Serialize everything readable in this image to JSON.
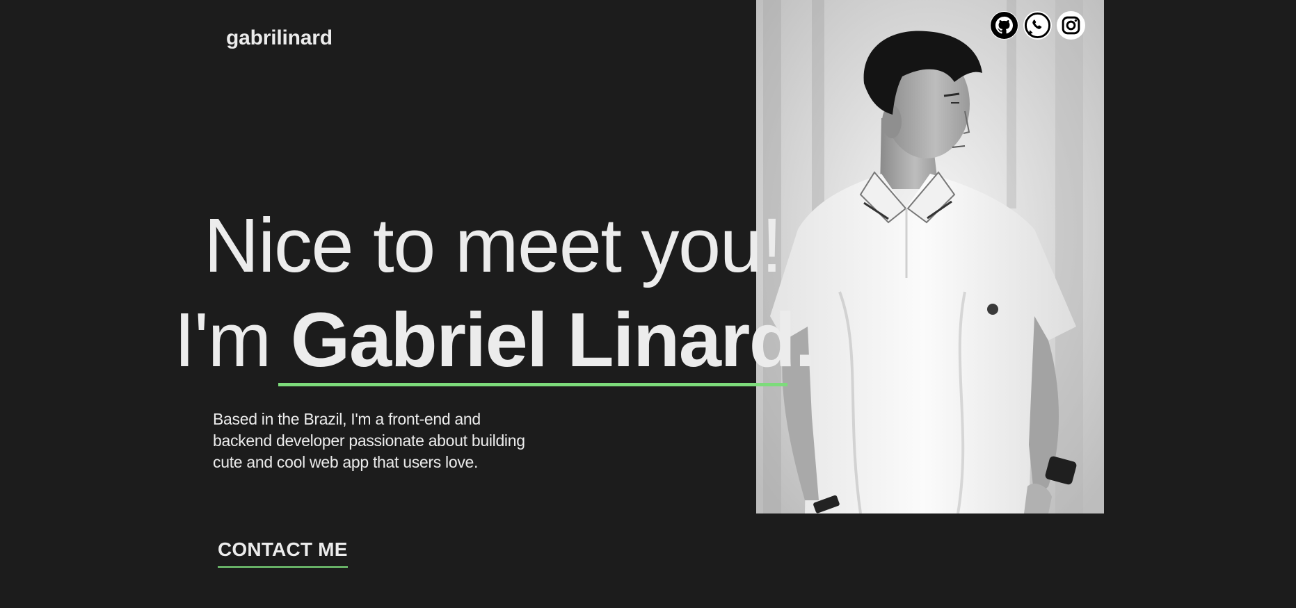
{
  "header": {
    "logo": "gabrilinard"
  },
  "socials": [
    {
      "name": "GitHub",
      "icon": "github-icon"
    },
    {
      "name": "WhatsApp",
      "icon": "whatsapp-icon"
    },
    {
      "name": "Instagram",
      "icon": "instagram-icon"
    }
  ],
  "hero": {
    "greeting": "Nice to meet you!",
    "intro_prefix": "I'm",
    "name": "Gabriel Linard.",
    "bio": "Based in the Brazil, I'm a front-end and backend developer passionate about building cute and cool web app that users love.",
    "cta_label": "CONTACT ME"
  },
  "colors": {
    "background": "#1c1c1c",
    "text": "#ececec",
    "accent": "#7ddb7b"
  }
}
